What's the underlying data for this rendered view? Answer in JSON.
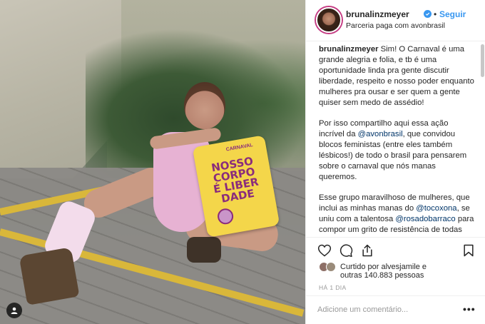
{
  "header": {
    "username": "brunalinzmeyer",
    "separator": "•",
    "follow_label": "Seguir",
    "partnership": "Parceria paga com avonbrasil"
  },
  "caption": {
    "p1_user": "brunalinzmeyer",
    "p1_text": " Sim! O Carnaval é uma grande alegria e folia, e tb é uma oportunidade linda pra gente discutir liberdade, respeito e nosso poder enquanto mulheres pra ousar e ser quem a gente quiser sem medo de assédio!",
    "p2_a": "Por isso compartilho aqui essa ação incrível da ",
    "p2_mention": "@avonbrasil",
    "p2_b": ", que convidou blocos feministas (entre eles também lésbicos!) de todo o brasil para pensarem sobre o carnaval que nós manas queremos.",
    "p3_a": "Esse grupo maravilhoso de mulheres, que inclui as minhas manas do ",
    "p3_mention1": "@tocoxona",
    "p3_b": ", se uniu com a talentosa ",
    "p3_mention2": "@rosadobarraco",
    "p3_c": " para compor um grito de resistência de todas nós nessa folia. a música \"O Carnaval Que Elas Querem\" é um"
  },
  "photo": {
    "sign_top": "CARNAVAL",
    "sign_text": "NOSSO\nCORPO\nÉ LIBER\nDADE"
  },
  "likes": {
    "line1": "Curtido por alvesjamile e",
    "line2": "outras 140.883 pessoas"
  },
  "time": "HÁ 1 DIA",
  "comment": {
    "placeholder": "Adicione um comentário..."
  },
  "more_label": "•••",
  "icons": [
    "heart-icon",
    "comment-icon",
    "share-icon",
    "bookmark-icon",
    "verified-icon",
    "user-tag-icon"
  ],
  "colors": {
    "accent": "#3897f0",
    "sign": "#f4d64a",
    "sign_text": "#8a2c7c"
  }
}
